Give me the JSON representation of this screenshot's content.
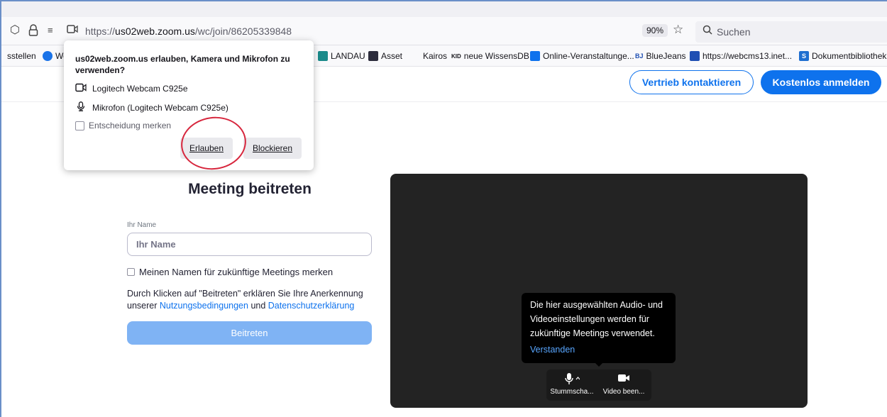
{
  "browser": {
    "url_prefix": "https://",
    "url_host": "us02web.zoom.us",
    "url_path": "/wc/join/86205339848",
    "zoom_level": "90%",
    "search_placeholder": "Suchen",
    "icons": [
      "shield-icon",
      "lock-icon",
      "permissions-icon",
      "camera-icon",
      "star-icon",
      "search-icon"
    ]
  },
  "bookmarks": [
    {
      "label": "sstellen",
      "color": ""
    },
    {
      "label": "We",
      "color": "#1a73e8"
    },
    {
      "label": "LANDAU",
      "color": "#1a8a8a"
    },
    {
      "label": "Asset",
      "color": "#2c2c3c"
    },
    {
      "label": "Kairos",
      "color": ""
    },
    {
      "label": "neue WissensDB",
      "color": "",
      "prefix": "KID"
    },
    {
      "label": "Online-Veranstaltunge...",
      "color": "#0e72ed"
    },
    {
      "label": "BlueJeans",
      "color": "#1f4fb3",
      "prefix": "BJ"
    },
    {
      "label": "https://webcms13.inet...",
      "color": "#1f4fb3"
    },
    {
      "label": "Dokumentbibliothek -",
      "color": "#1f6fd0",
      "prefix": "S"
    }
  ],
  "permission_popup": {
    "question": "us02web.zoom.us erlauben, Kamera und Mikrofon zu verwenden?",
    "camera": "Logitech Webcam C925e",
    "microphone": "Mikrofon (Logitech Webcam C925e)",
    "remember": "Entscheidung merken",
    "allow": "Erlauben",
    "block": "Blockieren"
  },
  "header": {
    "contact_sales": "Vertrieb kontaktieren",
    "signup": "Kostenlos anmelden"
  },
  "join_form": {
    "title": "Meeting beitreten",
    "name_label": "Ihr Name",
    "name_placeholder": "Ihr Name",
    "remember_label": "Meinen Namen für zukünftige Meetings merken",
    "terms_prefix": "Durch Klicken auf \"Beitreten\" erklären Sie Ihre Anerkennung unserer ",
    "terms_link": "Nutzungsbedingungen",
    "terms_mid": " und ",
    "privacy_link": "Datenschutzerklärung",
    "join_button": "Beitreten"
  },
  "preview": {
    "tooltip": "Die hier ausgewählten Audio- und Videoeinstellungen werden für zukünftige Meetings verwendet.",
    "tooltip_link": "Verstanden",
    "mute_label": "Stummscha...",
    "video_label": "Video been..."
  },
  "colors": {
    "accent": "#0e72ed",
    "annotation": "#d7263d",
    "preview_bg": "#232323"
  }
}
